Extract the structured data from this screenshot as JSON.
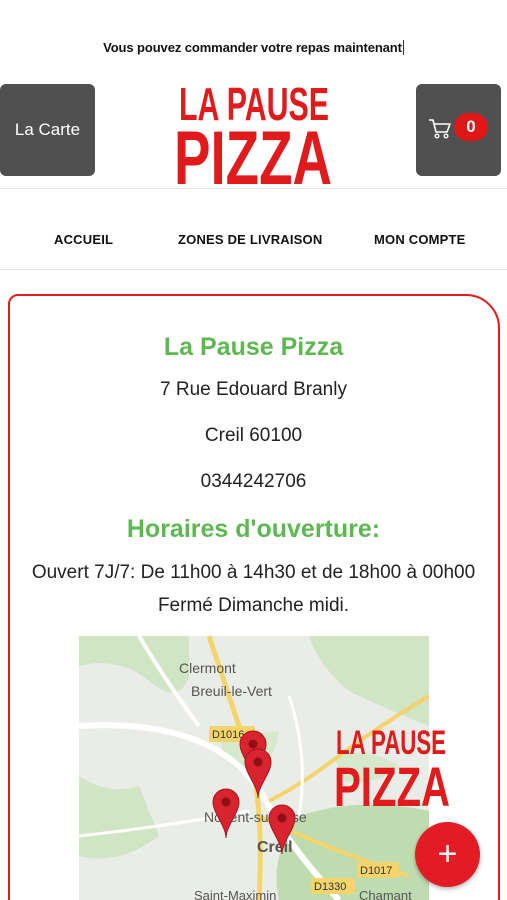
{
  "announcement": "Vous pouvez commander votre repas maintenant",
  "header": {
    "menu_button_label": "La Carte",
    "logo_line1": "LA PAUSE",
    "logo_line2": "PIZZA",
    "cart_icon": "cart-icon",
    "cart_count": "0"
  },
  "nav": [
    {
      "label": "ACCUEIL"
    },
    {
      "label": "ZONES DE LIVRAISON"
    },
    {
      "label": "MON COMPTE"
    }
  ],
  "info": {
    "name": "La Pause Pizza",
    "address": "7 Rue Edouard Branly",
    "city": "Creil 60100",
    "phone": "0344242706",
    "hours_title": "Horaires d'ouverture:",
    "hours_line1": "Ouvert 7J/7: De 11h00 à 14h30 et de 18h00 à 00h00",
    "hours_line2": "Fermé Dimanche midi."
  },
  "map": {
    "places": [
      "Clermont",
      "Breuil-le-Vert",
      "Nogent-sur-Oise",
      "Creil",
      "Saint-Maximin",
      "Chamant"
    ],
    "roads": [
      "D1016",
      "D1017",
      "D1330"
    ],
    "pin_color": "#d9232e"
  },
  "fab_label": "+",
  "colors": {
    "accent_red": "#e31b1b",
    "title_green": "#5db851",
    "button_gray": "#505050"
  }
}
